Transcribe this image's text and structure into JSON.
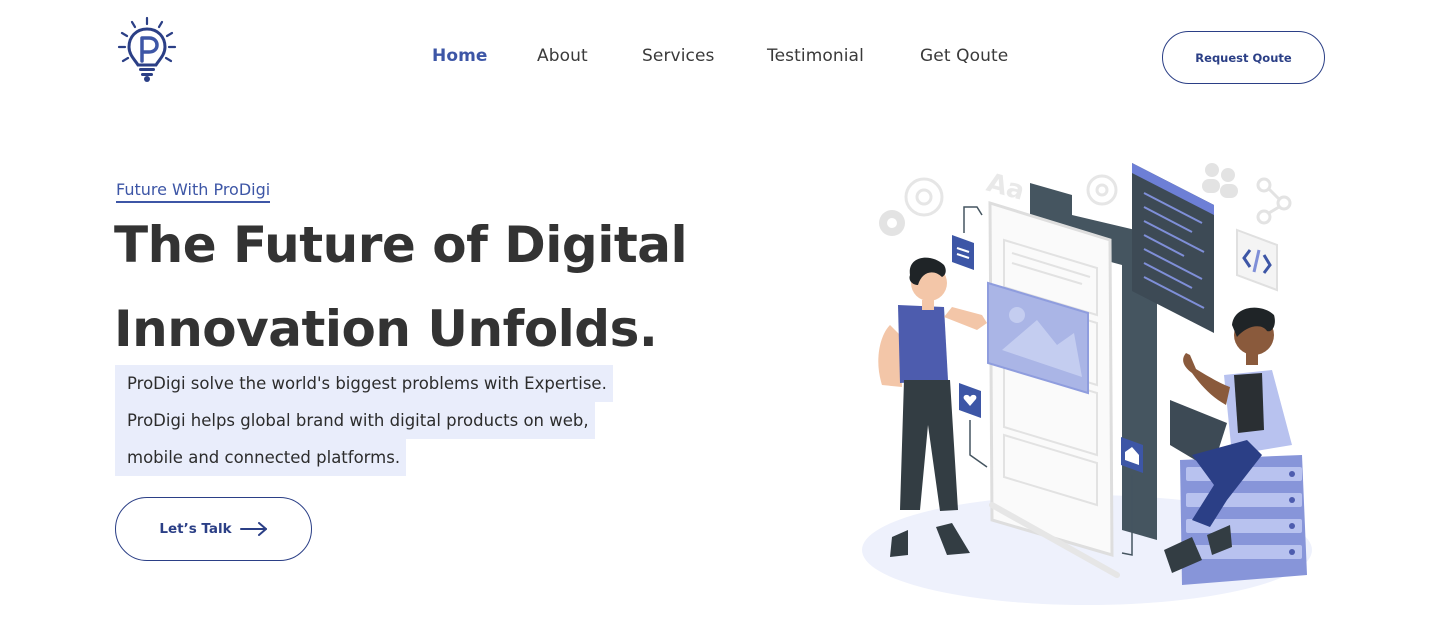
{
  "header": {
    "nav": [
      {
        "label": "Home",
        "active": true
      },
      {
        "label": "About",
        "active": false
      },
      {
        "label": "Services",
        "active": false
      },
      {
        "label": "Testimonial",
        "active": false
      },
      {
        "label": "Get Qoute",
        "active": false
      }
    ],
    "cta_label": "Request Qoute"
  },
  "hero": {
    "eyebrow": "Future With ProDigi",
    "headline_line1": "The Future of Digital",
    "headline_line2": "Innovation Unfolds.",
    "description_lines": [
      "ProDigi solve the world's biggest problems with Expertise.",
      "ProDigi helps global brand with digital products on web,",
      "mobile and connected platforms."
    ],
    "cta_label": "Let’s Talk"
  },
  "colors": {
    "brand": "#3d56a6",
    "brand_dark": "#2b3f86",
    "text": "#333333",
    "highlight": "#e9edfb",
    "phone_dark": "#455560"
  },
  "icons": [
    "lightbulb-p-logo-icon",
    "arrow-right-icon",
    "gear-icon",
    "document-icon",
    "heart-icon",
    "home-icon",
    "code-icon",
    "users-icon",
    "share-icon"
  ]
}
